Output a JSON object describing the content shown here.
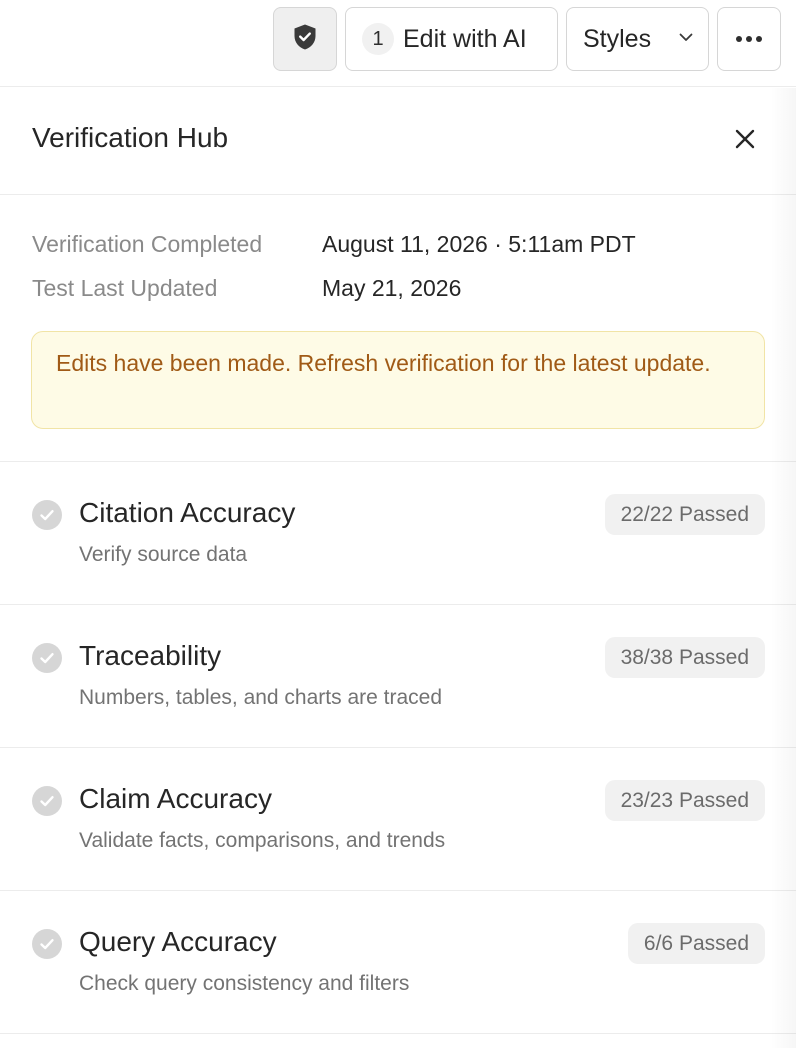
{
  "toolbar": {
    "shield_icon": "shield-check-icon",
    "edit_count": "1",
    "edit_label": "Edit with AI",
    "styles_label": "Styles",
    "more_icon": "more-horizontal-icon"
  },
  "panel": {
    "title": "Verification Hub",
    "close_icon": "close-icon"
  },
  "meta": {
    "completed_label": "Verification Completed",
    "completed_value": "August 11, 2026 · 5:11am PDT",
    "updated_label": "Test Last Updated",
    "updated_value": "May 21, 2026",
    "alert_text": "Edits have been made. Refresh verification for the latest update."
  },
  "checks": [
    {
      "title": "Citation Accuracy",
      "description": "Verify source data",
      "status": "22/22 Passed"
    },
    {
      "title": "Traceability",
      "description": "Numbers, tables, and charts are traced",
      "status": "38/38 Passed"
    },
    {
      "title": "Claim Accuracy",
      "description": "Validate facts, comparisons, and trends",
      "status": "23/23 Passed"
    },
    {
      "title": "Query Accuracy",
      "description": "Check query consistency and filters",
      "status": "6/6 Passed"
    }
  ],
  "colors": {
    "alert_bg": "#fefbe6",
    "alert_text": "#a05a16",
    "badge_bg": "#f1f1f1",
    "check_icon": "#d6d6d6"
  }
}
